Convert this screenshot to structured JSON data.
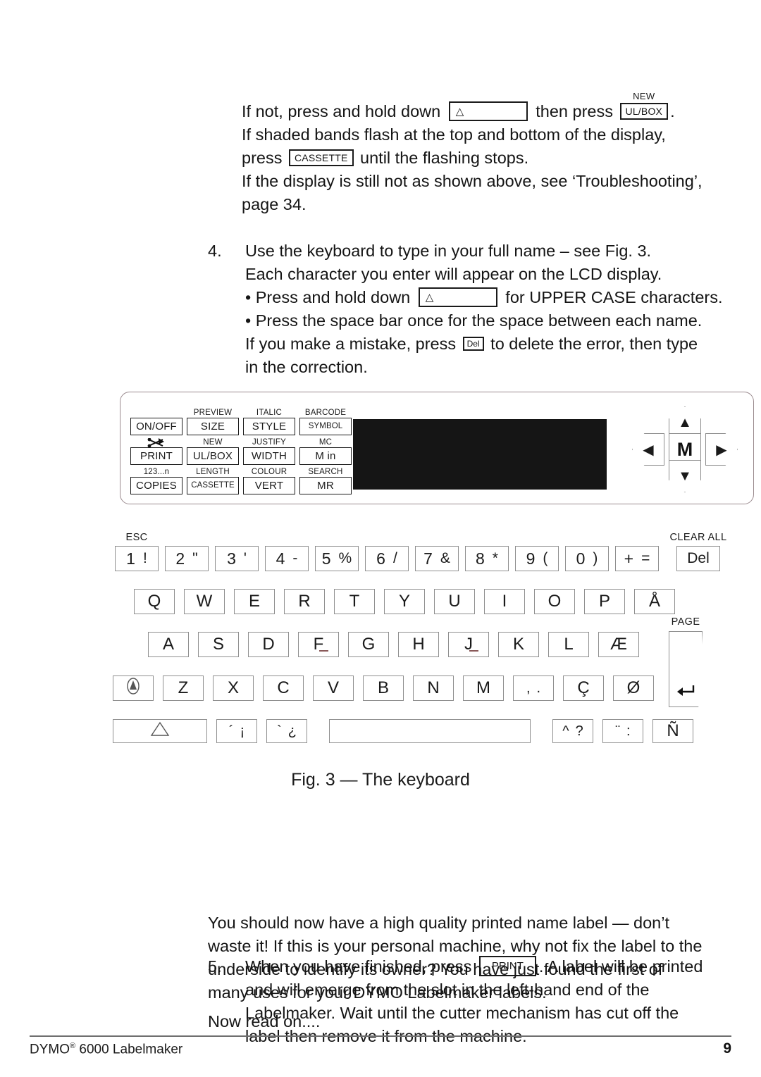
{
  "document": {
    "footer_left": "DYMO",
    "footer_left_suffix": " 6000 Labelmaker",
    "footer_registered": "®",
    "page_number": "9"
  },
  "intro": {
    "line1_a": "If not, press and hold down",
    "line1_b": "then press",
    "line1_c": ".",
    "shift_glyph": "△",
    "ulbox_over": "NEW",
    "ulbox_label": "UL/BOX",
    "line2": "If shaded bands flash at the top and bottom of the display,",
    "line3_a": "press",
    "cassette_label": "CASSETTE",
    "line3_b": "until the flashing stops.",
    "line4": "If the display is still not as shown above, see ‘Troubleshooting’,",
    "line5": "page 34."
  },
  "step4": {
    "number": "4.",
    "line1": "Use the keyboard to type in your full name – see Fig. 3.",
    "line2": "Each character you enter will appear on the LCD display.",
    "bullet1_a": "• Press and hold down",
    "bullet1_b": "for UPPER CASE characters.",
    "bullet2": "• Press the space bar once for the space between each name.",
    "line3_a": "If you make a mistake, press",
    "del_label": "Del",
    "line3_b": "to delete the error, then type",
    "line4": "in the correction."
  },
  "step5": {
    "number": "5.",
    "line1_a": "When you have finished, press",
    "print_label": "PRINT",
    "line1_b": ". A label will be printed",
    "line2": "and will emerge from the slot in the left-hand end of the",
    "line3": "Labelmaker. Wait until the cutter mechanism has cut off the",
    "line4": "label then remove it from the machine."
  },
  "closing": {
    "line1": "You should now have a high quality printed name label — don’t",
    "line2": "waste it! If this is your personal machine, why not fix the label to the",
    "line3": "underside to identify its owner? You have just found the first of",
    "line4": "many uses for your DYMO Labelmaker labels.",
    "line5": "Now read on...."
  },
  "figure": {
    "caption": "Fig. 3 — The keyboard",
    "control_panel": {
      "function_columns": [
        {
          "cells": [
            {
              "sub": "",
              "key": "ON/OFF",
              "icon": ""
            },
            {
              "sub": "",
              "key": "PRINT",
              "icon": "cutter-icon"
            },
            {
              "sub": "123...n",
              "key": "COPIES",
              "icon": ""
            }
          ]
        },
        {
          "cells": [
            {
              "sub": "PREVIEW",
              "key": "SIZE",
              "icon": ""
            },
            {
              "sub": "NEW",
              "key": "UL/BOX",
              "icon": ""
            },
            {
              "sub": "LENGTH",
              "key": "CASSETTE",
              "icon": ""
            }
          ]
        },
        {
          "cells": [
            {
              "sub": "ITALIC",
              "key": "STYLE",
              "icon": ""
            },
            {
              "sub": "JUSTIFY",
              "key": "WIDTH",
              "icon": ""
            },
            {
              "sub": "COLOUR",
              "key": "VERT",
              "icon": ""
            }
          ]
        },
        {
          "cells": [
            {
              "sub": "BARCODE",
              "key": "SYMBOL",
              "icon": ""
            },
            {
              "sub": "MC",
              "key": "M  in",
              "icon": ""
            },
            {
              "sub": "SEARCH",
              "key": "MR",
              "icon": ""
            }
          ]
        }
      ],
      "nav": {
        "up": "▲",
        "down": "▼",
        "left": "◀",
        "right": "▶",
        "center": "M"
      }
    },
    "keyboard": {
      "row_numbers": {
        "esc_label": "ESC",
        "clear_all_label": "CLEAR  ALL",
        "keys": [
          {
            "primary": "1",
            "secondary": "!"
          },
          {
            "primary": "2",
            "secondary": "\""
          },
          {
            "primary": "3",
            "secondary": "'"
          },
          {
            "primary": "4",
            "secondary": "-"
          },
          {
            "primary": "5",
            "secondary": "%"
          },
          {
            "primary": "6",
            "secondary": "/"
          },
          {
            "primary": "7",
            "secondary": "&"
          },
          {
            "primary": "8",
            "secondary": "*"
          },
          {
            "primary": "9",
            "secondary": "("
          },
          {
            "primary": "0",
            "secondary": ")"
          },
          {
            "primary": "+",
            "secondary": "="
          }
        ],
        "del_key": "Del"
      },
      "row_top": [
        "Q",
        "W",
        "E",
        "R",
        "T",
        "Y",
        "U",
        "I",
        "O",
        "P",
        "Å"
      ],
      "row_home": [
        "A",
        "S",
        "D",
        "F",
        "G",
        "H",
        "J",
        "K",
        "L",
        "Æ"
      ],
      "row_bottom": [
        "Z",
        "X",
        "C",
        "V",
        "B",
        "N",
        "M"
      ],
      "row_bottom_caps_icon": "caps-lock-icon",
      "row_bottom_punct": {
        "primary": ",",
        "secondary": "."
      },
      "row_bottom_extra": [
        "Ç",
        "Ø"
      ],
      "row_space": {
        "shift_icon": "△",
        "accent_acute": {
          "primary": "´",
          "secondary": "¡"
        },
        "accent_grave": {
          "primary": "`",
          "secondary": "¿"
        },
        "space_label": "",
        "caret_key": {
          "primary": "^",
          "secondary": "?"
        },
        "diaeresis_key": {
          "primary": "¨",
          "secondary": ":"
        },
        "tilde_key": "Ñ"
      },
      "enter": {
        "page_label": "PAGE",
        "glyph": "↵"
      }
    }
  }
}
